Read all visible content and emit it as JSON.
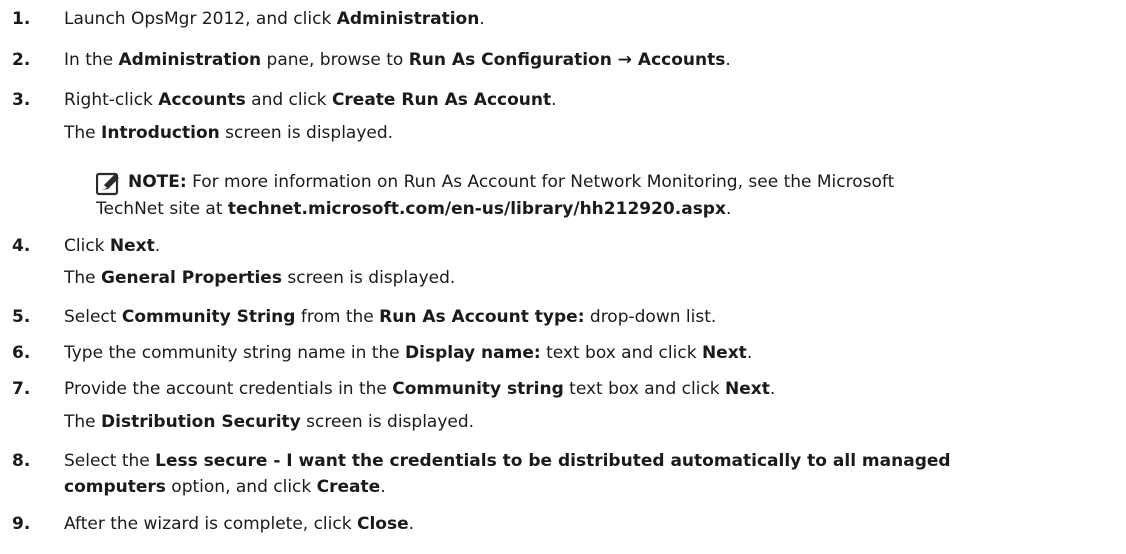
{
  "steps": [
    {
      "num": "1.",
      "parts": [
        "Launch OpsMgr 2012, and click ",
        "Administration",
        "."
      ]
    },
    {
      "num": "2.",
      "parts": [
        "In the ",
        "Administration",
        " pane, browse to ",
        "Run As Configuration → Accounts",
        "."
      ]
    },
    {
      "num": "3.",
      "parts": [
        "Right-click ",
        "Accounts",
        " and click ",
        "Create Run As Account",
        "."
      ],
      "sub": [
        "The ",
        "Introduction",
        " screen is displayed."
      ]
    },
    {
      "num": "4.",
      "parts": [
        "Click ",
        "Next",
        "."
      ],
      "sub": [
        "The ",
        "General Properties",
        " screen is displayed."
      ]
    },
    {
      "num": "5.",
      "parts": [
        "Select ",
        "Community String",
        " from the ",
        "Run As Account type:",
        " drop-down list."
      ]
    },
    {
      "num": "6.",
      "parts": [
        "Type the community string name in the ",
        "Display name:",
        " text box and click ",
        "Next",
        "."
      ]
    },
    {
      "num": "7.",
      "parts": [
        "Provide the account credentials in the ",
        "Community string",
        " text box and click ",
        "Next",
        "."
      ],
      "sub": [
        "The ",
        "Distribution Security",
        " screen is displayed."
      ]
    },
    {
      "num": "8.",
      "parts": [
        "Select the ",
        "Less secure - I want the credentials to be distributed automatically to all managed",
        ""
      ],
      "cont": [
        "computers",
        " option, and click ",
        "Create",
        "."
      ]
    },
    {
      "num": "9.",
      "parts": [
        "After the wizard is complete, click ",
        "Close",
        "."
      ]
    }
  ],
  "note": {
    "label": "NOTE:",
    "line1": " For more information on Run As Account for Network Monitoring, see the Microsoft",
    "line2_pre": "TechNet site at ",
    "line2_link": "technet.microsoft.com/en-us/library/hh212920.aspx",
    "line2_post": "."
  }
}
